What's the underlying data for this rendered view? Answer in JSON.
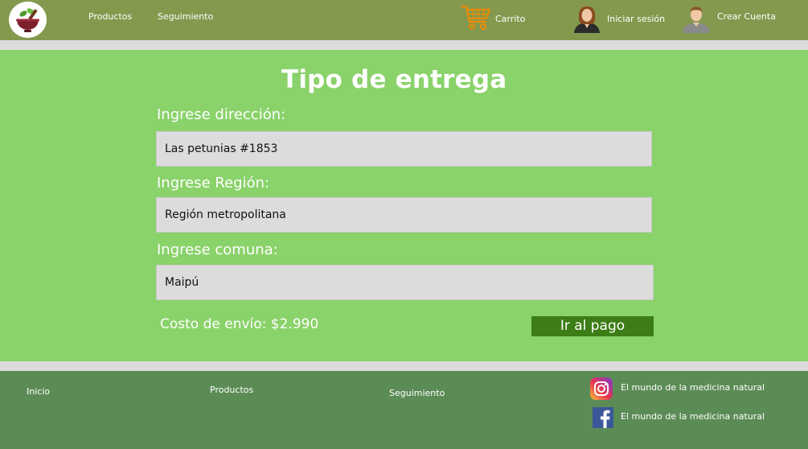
{
  "header": {
    "nav": [
      {
        "label": "Productos"
      },
      {
        "label": "Seguimiento"
      }
    ],
    "cart_label": "Carrito",
    "login_label": "Iniciar sesión",
    "signup_label": "Crear Cuenta"
  },
  "main": {
    "title": "Tipo de entrega",
    "address_label": "Ingrese dirección:",
    "address_value": "Las petunias #1853",
    "region_label": "Ingrese Región:",
    "region_value": "Región metropolitana",
    "comuna_label": "Ingrese comuna:",
    "comuna_value": "Maipú",
    "shipping_cost": "Costo de envío: $2.990",
    "pay_button": "Ir al pago"
  },
  "footer": {
    "links": [
      {
        "label": "Inicio"
      },
      {
        "label": "Productos"
      },
      {
        "label": "Seguimiento"
      }
    ],
    "social": [
      {
        "icon": "instagram-icon",
        "label": "El mundo de la medicina natural"
      },
      {
        "icon": "facebook-icon",
        "label": "El mundo de la medicina natural"
      }
    ]
  },
  "colors": {
    "header_bg": "#84994e",
    "main_bg": "#8ad26a",
    "footer_bg": "#5c8c56",
    "button_bg": "#3c7d15",
    "cart_orange": "#f08a00",
    "input_bg": "#dcdcdc"
  }
}
